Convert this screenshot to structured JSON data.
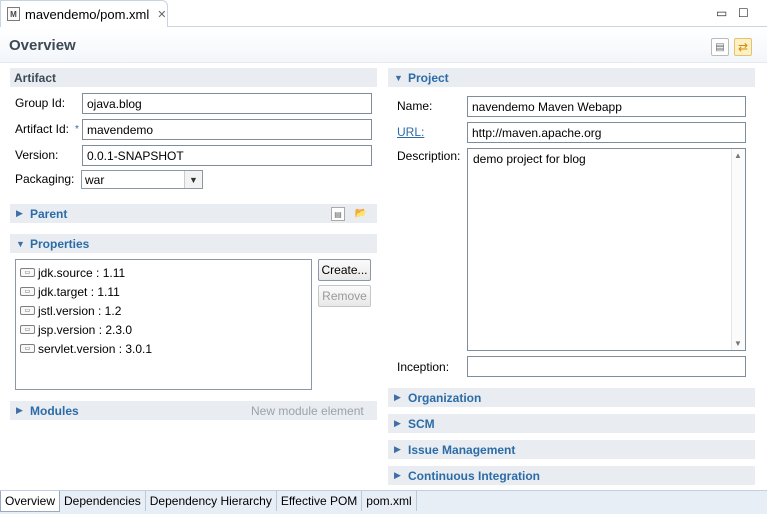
{
  "editor_tab": {
    "title": "mavendemo/pom.xml",
    "icon": "xml-file-icon",
    "close": "✕"
  },
  "window_controls": {
    "minimize": "▭",
    "maximize": "☐"
  },
  "header": {
    "title": "Overview"
  },
  "artifact": {
    "section_label": "Artifact",
    "group_id_label": "Group Id:",
    "group_id_value": "ojava.blog",
    "artifact_id_label": "Artifact Id:",
    "artifact_id_value": "mavendemo",
    "required_marker": "*",
    "version_label": "Version:",
    "version_value": "0.0.1-SNAPSHOT",
    "packaging_label": "Packaging:",
    "packaging_value": "war"
  },
  "parent": {
    "section_label": "Parent"
  },
  "properties": {
    "section_label": "Properties",
    "items": [
      "jdk.source : 1.11",
      "jdk.target : 1.11",
      "jstl.version : 1.2",
      "jsp.version : 2.3.0",
      "servlet.version : 3.0.1"
    ],
    "create_label": "Create...",
    "remove_label": "Remove"
  },
  "modules": {
    "section_label": "Modules",
    "new_module_label": "New module element"
  },
  "project": {
    "section_label": "Project",
    "name_label": "Name:",
    "name_value": "navendemo Maven Webapp",
    "url_label": "URL:",
    "url_value": "http://maven.apache.org",
    "description_label": "Description:",
    "description_value": "demo project for blog",
    "inception_label": "Inception:",
    "inception_value": ""
  },
  "collapsed_sections": {
    "organization": "Organization",
    "scm": "SCM",
    "issue_management": "Issue Management",
    "continuous_integration": "Continuous Integration"
  },
  "page_tabs": {
    "overview": "Overview",
    "dependencies": "Dependencies",
    "dependency_hierarchy": "Dependency Hierarchy",
    "effective_pom": "Effective POM",
    "pom_xml": "pom.xml"
  },
  "colors": {
    "section_title": "#2b6ca8",
    "section_bg": "#e9ecf0"
  }
}
